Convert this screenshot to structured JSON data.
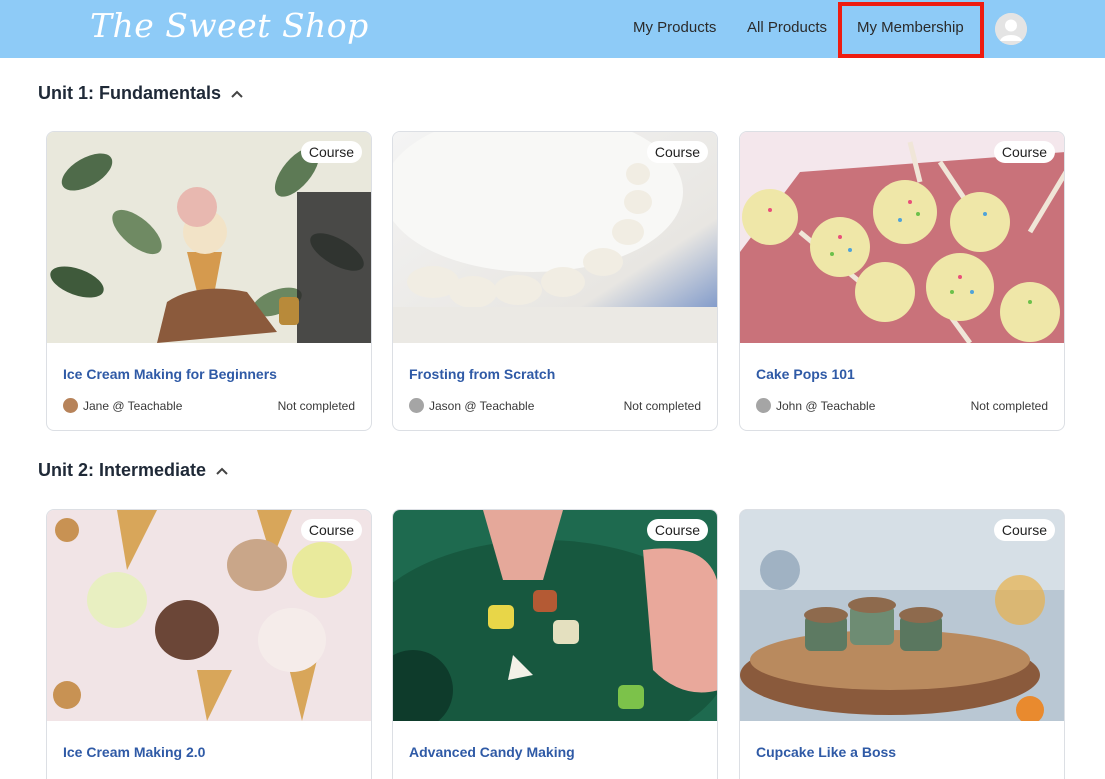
{
  "header": {
    "logo": "The Sweet Shop",
    "nav": {
      "my_products": "My Products",
      "all_products": "All Products",
      "my_membership": "My Membership"
    },
    "highlight_color": "#ee1c10",
    "avatar_icon": "user-avatar-icon"
  },
  "units": [
    {
      "title": "Unit 1: Fundamentals",
      "cards": [
        {
          "badge": "Course",
          "title": "Ice Cream Making for Beginners",
          "author": "Jane @ Teachable",
          "status": "Not completed"
        },
        {
          "badge": "Course",
          "title": "Frosting from Scratch",
          "author": "Jason @ Teachable",
          "status": "Not completed"
        },
        {
          "badge": "Course",
          "title": "Cake Pops 101",
          "author": "John @ Teachable",
          "status": "Not completed"
        }
      ]
    },
    {
      "title": "Unit 2: Intermediate",
      "cards": [
        {
          "badge": "Course",
          "title": "Ice Cream Making 2.0"
        },
        {
          "badge": "Course",
          "title": "Advanced Candy Making"
        },
        {
          "badge": "Course",
          "title": "Cupcake Like a Boss"
        }
      ]
    }
  ],
  "colors": {
    "header_bg": "#8ecbf7",
    "card_title": "#2f5aa6"
  }
}
